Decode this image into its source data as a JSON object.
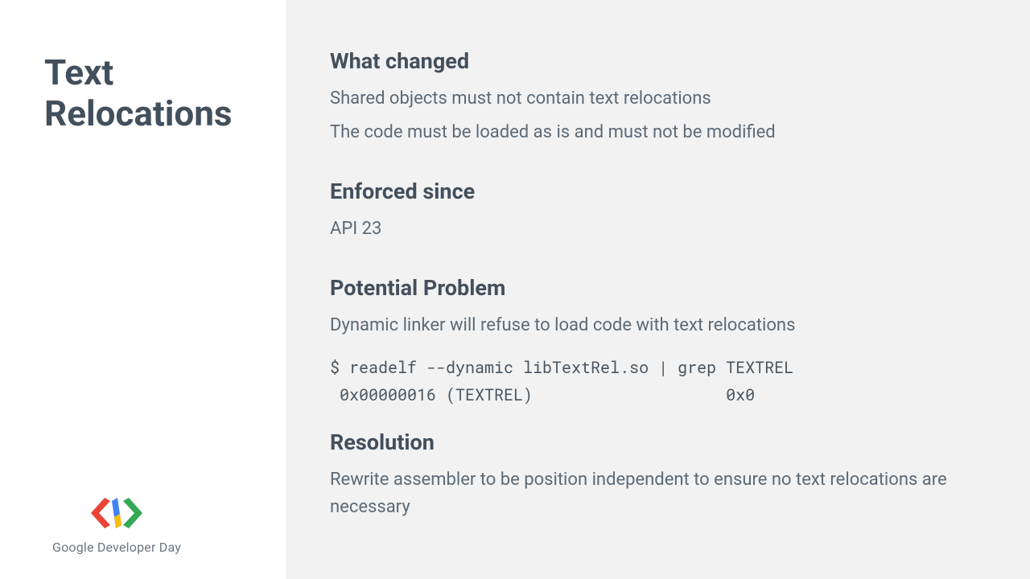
{
  "slide": {
    "title": "Text Relocations"
  },
  "sections": {
    "what_changed": {
      "heading": "What changed",
      "line1": "Shared objects must not contain text relocations",
      "line2": "The code must be loaded as is and must not be modified"
    },
    "enforced_since": {
      "heading": "Enforced since",
      "line1": "API 23"
    },
    "potential_problem": {
      "heading": "Potential Problem",
      "line1": "Dynamic linker will refuse to load code with text relocations",
      "code": "$ readelf --dynamic libTextRel.so | grep TEXTREL\n 0x00000016 (TEXTREL)                    0x0"
    },
    "resolution": {
      "heading": "Resolution",
      "line1": "Rewrite assembler to be position independent to ensure no text relocations are necessary"
    }
  },
  "footer": {
    "brand": "Google Developer Day"
  }
}
